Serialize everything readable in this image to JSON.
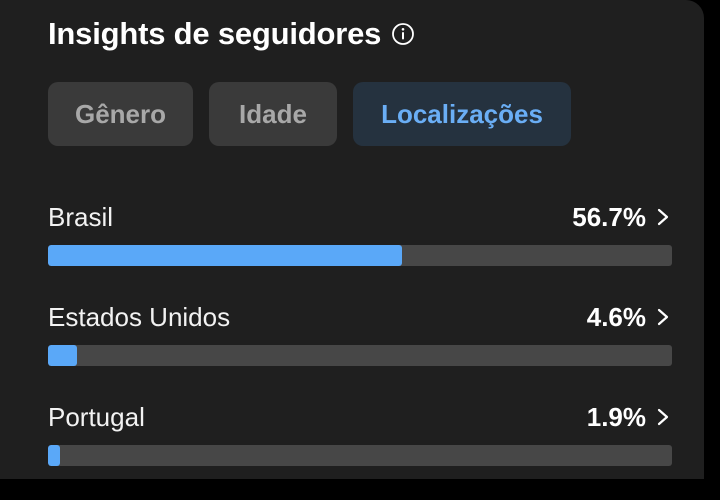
{
  "header": {
    "title": "Insights de seguidores",
    "info_icon": "info-icon"
  },
  "tabs": [
    {
      "label": "Gênero",
      "active": false
    },
    {
      "label": "Idade",
      "active": false
    },
    {
      "label": "Localizações",
      "active": true
    }
  ],
  "locations": [
    {
      "name": "Brasil",
      "percent_label": "56.7%",
      "percent": 56.7
    },
    {
      "name": "Estados Unidos",
      "percent_label": "4.6%",
      "percent": 4.6
    },
    {
      "name": "Portugal",
      "percent_label": "1.9%",
      "percent": 1.9
    }
  ],
  "colors": {
    "accent": "#5aa8f8",
    "track": "#474747",
    "card": "#1f1f1f"
  }
}
